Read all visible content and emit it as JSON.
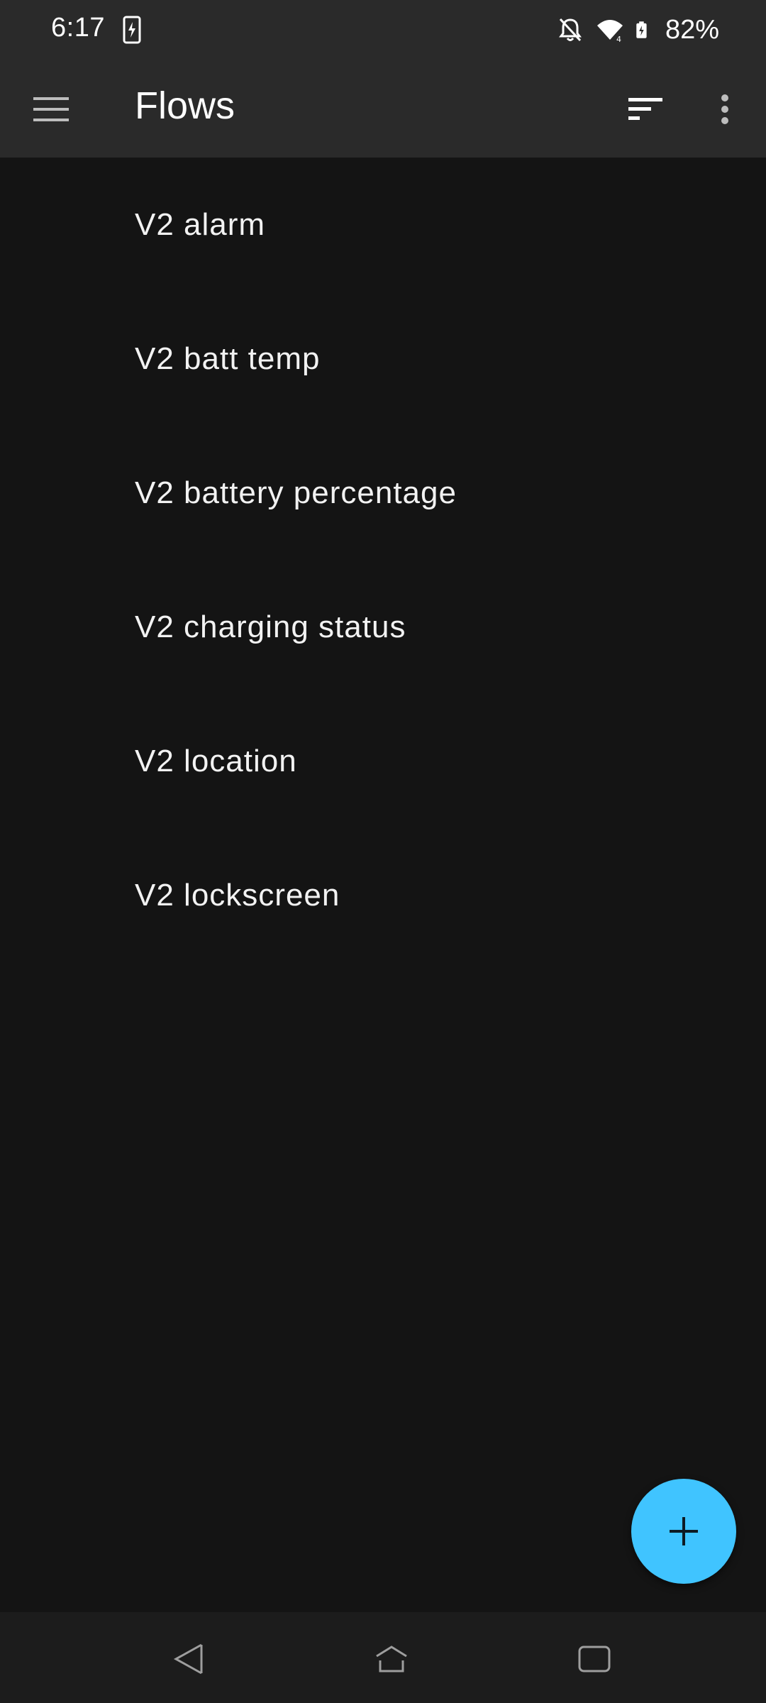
{
  "status_bar": {
    "time": "6:17",
    "battery": "82%",
    "icons": [
      "device-charging-icon",
      "notifications-off-icon",
      "wifi-icon",
      "battery-charging-icon"
    ]
  },
  "toolbar": {
    "title": "Flows",
    "icons": [
      "menu-icon",
      "sort-icon",
      "more-vert-icon"
    ]
  },
  "flows": [
    {
      "label": "V2 alarm"
    },
    {
      "label": "V2 batt temp"
    },
    {
      "label": "V2 battery percentage"
    },
    {
      "label": "V2 charging status"
    },
    {
      "label": "V2 location"
    },
    {
      "label": "V2 lockscreen"
    }
  ],
  "fab": {
    "icon": "plus-icon",
    "color": "#40c4ff"
  },
  "nav_bar": {
    "icons": [
      "back-icon",
      "home-icon",
      "recents-icon"
    ]
  },
  "colors": {
    "background": "#141414",
    "toolbar": "#2a2a2a",
    "accent": "#40c4ff",
    "text": "#ffffff"
  }
}
